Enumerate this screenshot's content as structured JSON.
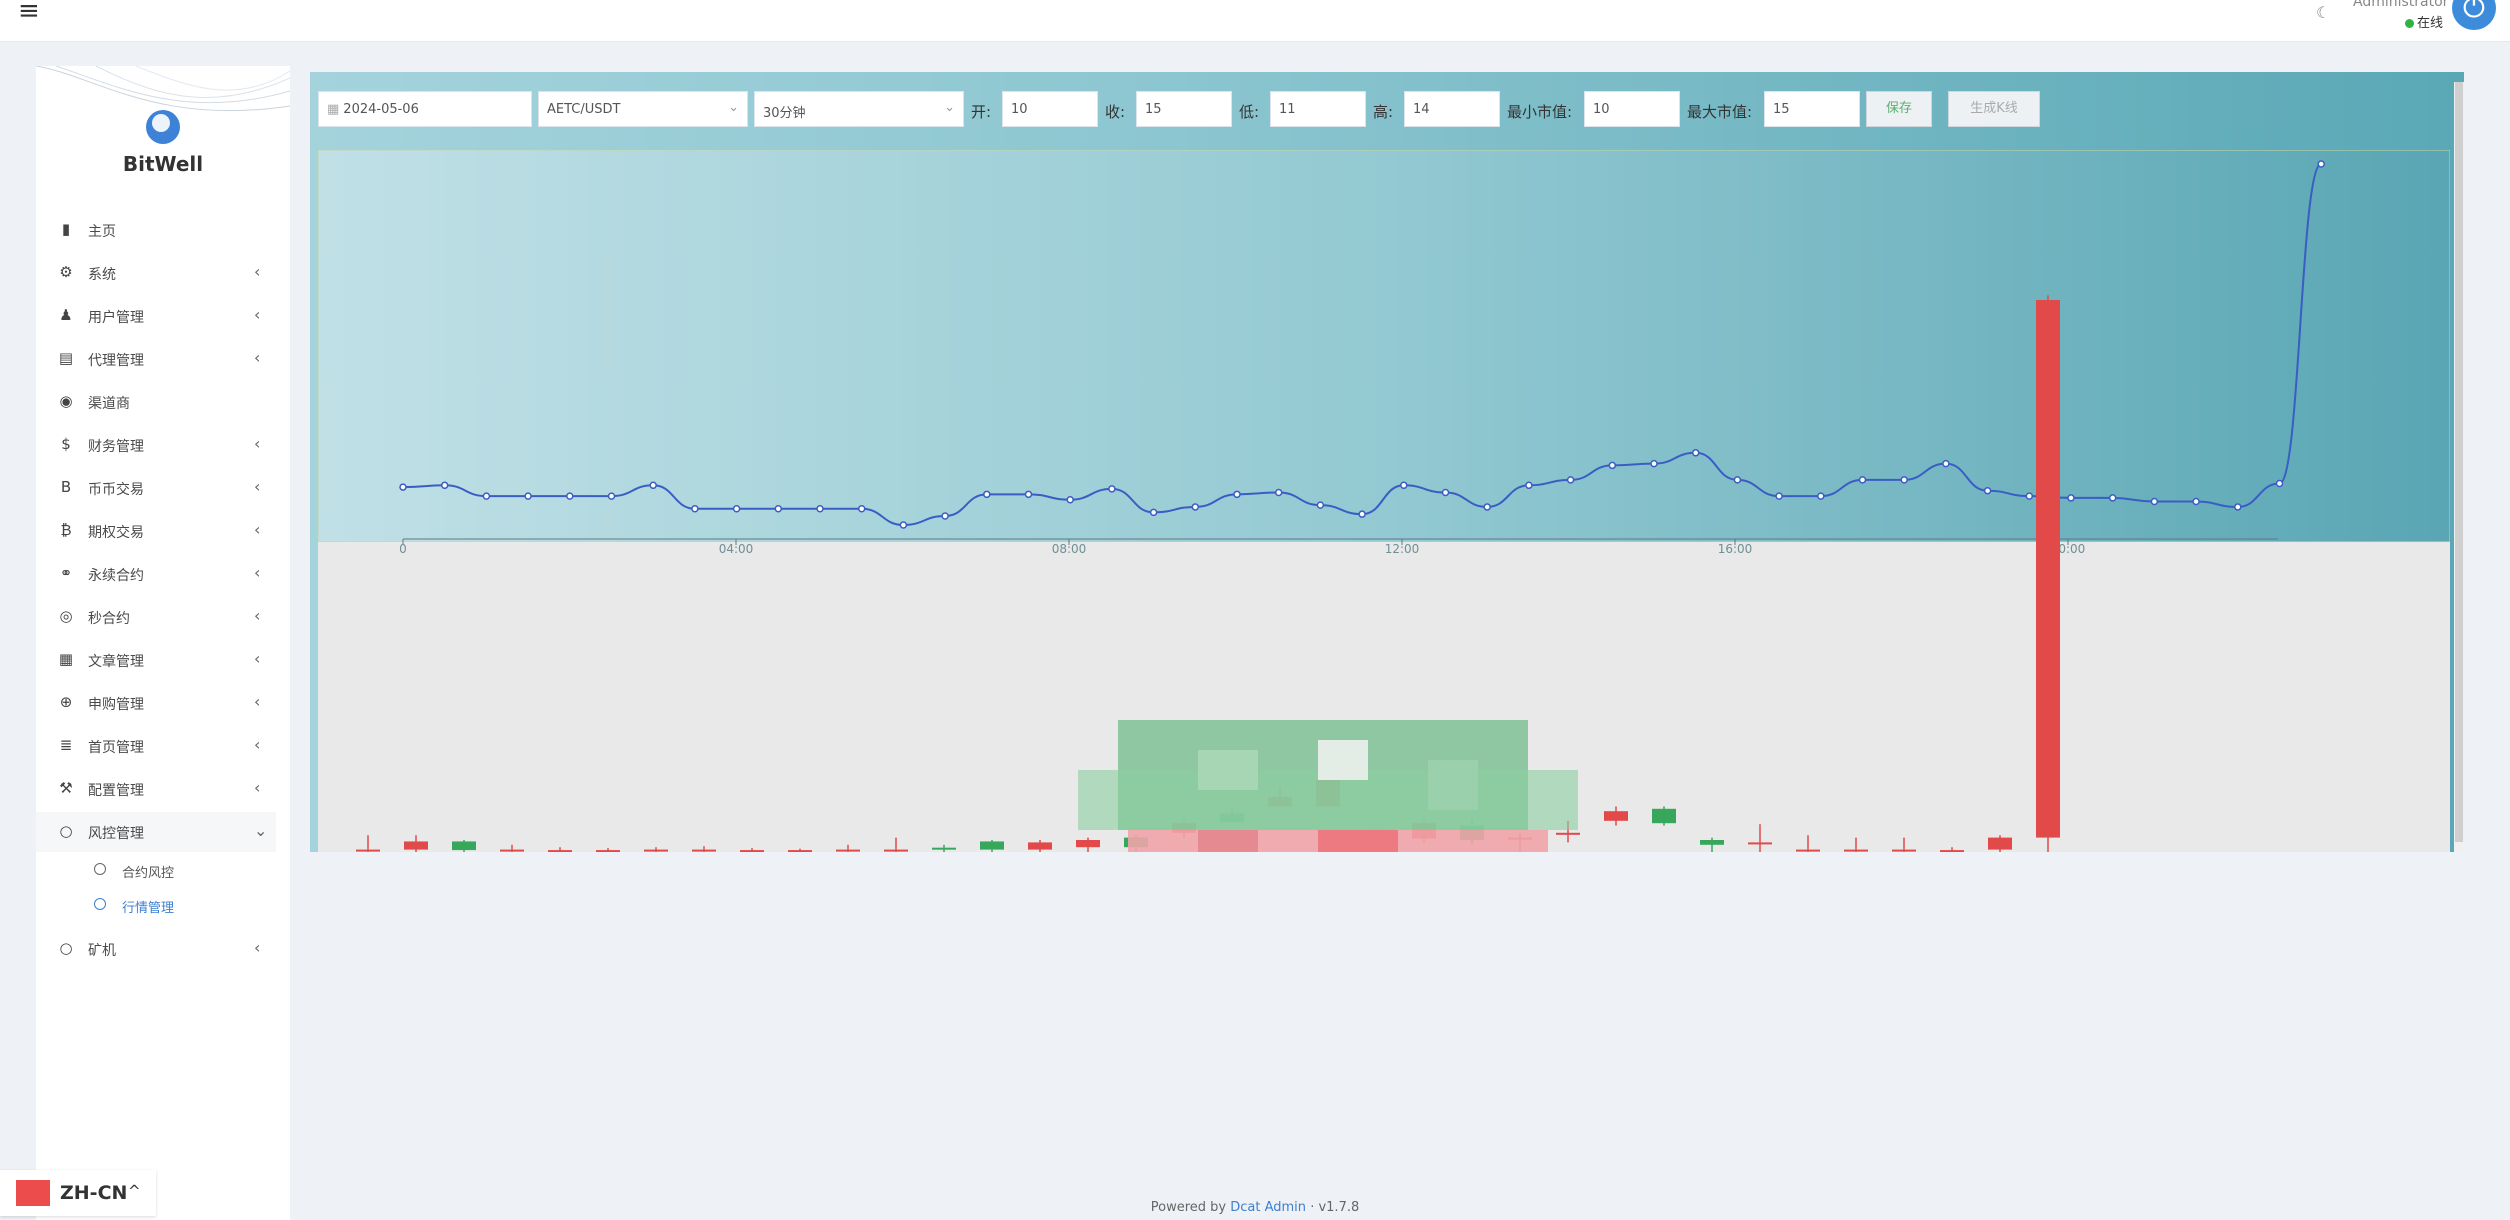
{
  "topbar": {
    "menu_icon": "hamburger-icon",
    "theme_icon": "moon-icon",
    "user_name": "Administrator",
    "user_status": "在线",
    "status_color": "#2fb344",
    "power_icon": "power-icon"
  },
  "brand": {
    "name": "BitWell",
    "logo_color": "#3d82d6"
  },
  "sidebar": {
    "items": [
      {
        "icon": "bar-chart-icon",
        "label": "主页",
        "has_children": false
      },
      {
        "icon": "gear-icon",
        "label": "系统",
        "has_children": true
      },
      {
        "icon": "user-icon",
        "label": "用户管理",
        "has_children": true
      },
      {
        "icon": "id-card-icon",
        "label": "代理管理",
        "has_children": true
      },
      {
        "icon": "user-circle-icon",
        "label": "渠道商",
        "has_children": false
      },
      {
        "icon": "dollar-icon",
        "label": "财务管理",
        "has_children": true
      },
      {
        "icon": "bitcoin-b-icon",
        "label": "币币交易",
        "has_children": true
      },
      {
        "icon": "bitcoin-icon",
        "label": "期权交易",
        "has_children": true
      },
      {
        "icon": "link-icon",
        "label": "永续合约",
        "has_children": true
      },
      {
        "icon": "target-icon",
        "label": "秒合约",
        "has_children": true
      },
      {
        "icon": "newspaper-icon",
        "label": "文章管理",
        "has_children": true
      },
      {
        "icon": "life-ring-icon",
        "label": "申购管理",
        "has_children": true
      },
      {
        "icon": "list-icon",
        "label": "首页管理",
        "has_children": true
      },
      {
        "icon": "wrench-icon",
        "label": "配置管理",
        "has_children": true
      },
      {
        "icon": "circle-icon",
        "label": "风控管理",
        "has_children": true,
        "expanded": true
      },
      {
        "icon": "circle-icon",
        "label": "矿机",
        "has_children": true
      }
    ],
    "sub_items": [
      {
        "label": "合约风控",
        "current": false
      },
      {
        "label": "行情管理",
        "current": true
      }
    ]
  },
  "toolbar": {
    "date": "2024-05-06",
    "date_icon": "calendar-icon",
    "pair": "AETC/USDT",
    "interval": "30分钟",
    "open_label": "开:",
    "open_value": "10",
    "close_label": "收:",
    "close_value": "15",
    "low_label": "低:",
    "low_value": "11",
    "high_label": "高:",
    "high_value": "14",
    "min_label": "最小市值:",
    "min_value": "10",
    "max_label": "最大市值:",
    "max_value": "15",
    "save_label": "保存",
    "generate_label": "生成K线",
    "save_color": "#5ab06e"
  },
  "chart_data": {
    "type": "line",
    "x_tick_labels": [
      "0",
      "04:00",
      "08:00",
      "12:00",
      "16:00",
      "20:00"
    ],
    "line_points": [
      0.105,
      0.11,
      0.08,
      0.08,
      0.08,
      0.08,
      0.11,
      0.045,
      0.045,
      0.045,
      0.045,
      0.045,
      0.0,
      0.025,
      0.085,
      0.085,
      0.07,
      0.1,
      0.035,
      0.05,
      0.085,
      0.09,
      0.055,
      0.03,
      0.11,
      0.09,
      0.05,
      0.11,
      0.125,
      0.165,
      0.17,
      0.2,
      0.125,
      0.08,
      0.08,
      0.125,
      0.125,
      0.17,
      0.095,
      0.08,
      0.075,
      0.075,
      0.065,
      0.065,
      0.05,
      0.115,
      1.0
    ],
    "line_color": "#3a5dc4",
    "bull_color": "#e24a4a",
    "bear_color": "#37a85b",
    "candles": [
      {
        "o": 0.05,
        "c": 0.05,
        "l": 0.0,
        "h": 0.35
      },
      {
        "o": 0.05,
        "c": 0.22,
        "l": 0.0,
        "h": 0.35
      },
      {
        "o": 0.22,
        "c": 0.04,
        "l": 0.0,
        "h": 0.25
      },
      {
        "o": 0.05,
        "c": 0.05,
        "l": 0.0,
        "h": 0.15
      },
      {
        "o": 0.04,
        "c": 0.04,
        "l": 0.0,
        "h": 0.1
      },
      {
        "o": 0.04,
        "c": 0.04,
        "l": 0.0,
        "h": 0.08
      },
      {
        "o": 0.05,
        "c": 0.05,
        "l": 0.0,
        "h": 0.1
      },
      {
        "o": 0.05,
        "c": 0.05,
        "l": 0.0,
        "h": 0.12
      },
      {
        "o": 0.04,
        "c": 0.04,
        "l": 0.0,
        "h": 0.08
      },
      {
        "o": 0.04,
        "c": 0.04,
        "l": 0.0,
        "h": 0.07
      },
      {
        "o": 0.05,
        "c": 0.05,
        "l": 0.0,
        "h": 0.15
      },
      {
        "o": 0.05,
        "c": 0.05,
        "l": 0.0,
        "h": 0.3
      },
      {
        "o": 0.09,
        "c": 0.05,
        "l": 0.0,
        "h": 0.15
      },
      {
        "o": 0.22,
        "c": 0.05,
        "l": 0.0,
        "h": 0.25
      },
      {
        "o": 0.05,
        "c": 0.2,
        "l": 0.0,
        "h": 0.25
      },
      {
        "o": 0.1,
        "c": 0.25,
        "l": 0.0,
        "h": 0.3
      },
      {
        "o": 0.3,
        "c": 0.1,
        "l": 0.0,
        "h": 0.35
      },
      {
        "o": 0.4,
        "c": 0.6,
        "l": 0.3,
        "h": 0.65
      },
      {
        "o": 0.8,
        "c": 0.62,
        "l": 0.6,
        "h": 0.9
      },
      {
        "o": 0.95,
        "c": 1.15,
        "l": 0.88,
        "h": 1.35
      },
      {
        "o": 0.95,
        "c": 1.5,
        "l": 0.9,
        "h": 1.7
      },
      {
        "o": 0.3,
        "c": 0.3,
        "l": 0.0,
        "h": 0.5
      },
      {
        "o": 0.28,
        "c": 0.6,
        "l": 0.2,
        "h": 0.65
      },
      {
        "o": 0.55,
        "c": 0.25,
        "l": 0.15,
        "h": 0.7
      },
      {
        "o": 0.3,
        "c": 0.3,
        "l": 0.0,
        "h": 0.4
      },
      {
        "o": 0.4,
        "c": 0.4,
        "l": 0.2,
        "h": 0.65
      },
      {
        "o": 0.65,
        "c": 0.85,
        "l": 0.55,
        "h": 0.95
      },
      {
        "o": 0.9,
        "c": 0.6,
        "l": 0.55,
        "h": 0.95
      },
      {
        "o": 0.25,
        "c": 0.15,
        "l": 0.0,
        "h": 0.3
      },
      {
        "o": 0.2,
        "c": 0.2,
        "l": 0.0,
        "h": 0.58
      },
      {
        "o": 0.05,
        "c": 0.05,
        "l": 0.0,
        "h": 0.35
      },
      {
        "o": 0.05,
        "c": 0.05,
        "l": 0.0,
        "h": 0.3
      },
      {
        "o": 0.05,
        "c": 0.05,
        "l": 0.0,
        "h": 0.3
      },
      {
        "o": 0.04,
        "c": 0.04,
        "l": 0.0,
        "h": 0.1
      },
      {
        "o": 0.05,
        "c": 0.3,
        "l": 0.0,
        "h": 0.35
      },
      {
        "o": 0.3,
        "c": 11.5,
        "l": 0.0,
        "h": 11.6
      }
    ]
  },
  "footer": {
    "prefix": "Powered by",
    "link": "Dcat Admin",
    "sep": "·",
    "version": "v1.7.8"
  },
  "lang": {
    "code": "ZH-CN",
    "caret": "^"
  }
}
